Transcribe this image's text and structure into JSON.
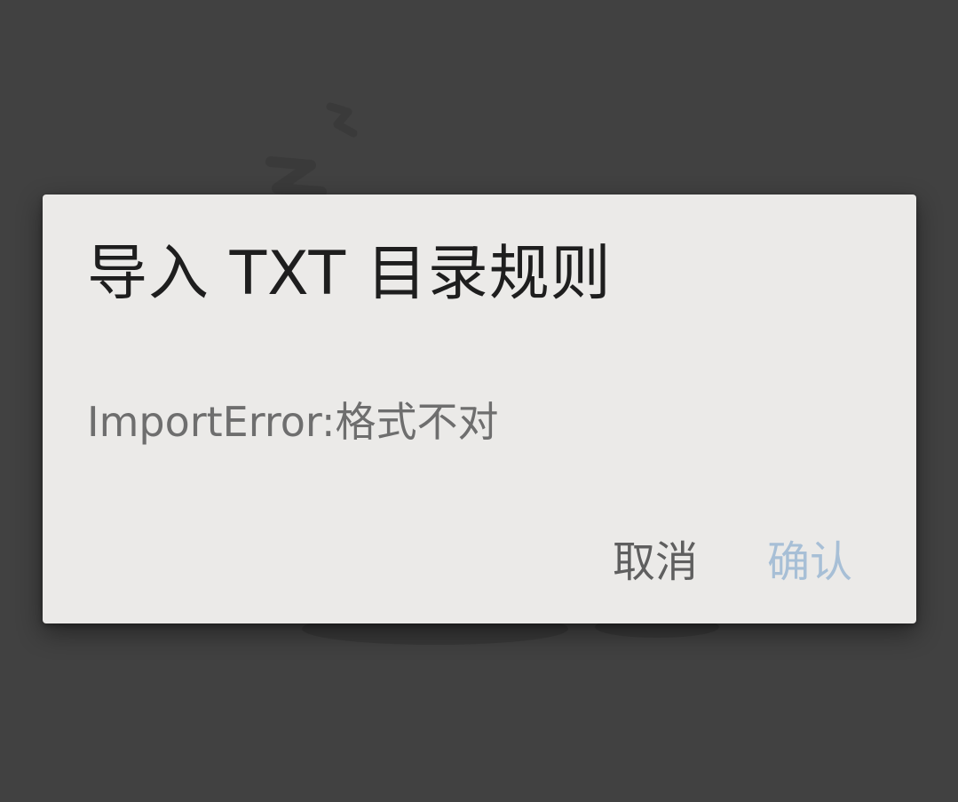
{
  "dialog": {
    "title": "导入 TXT 目录规则",
    "message": "ImportError:格式不对",
    "cancel_label": "取消",
    "confirm_label": "确认"
  },
  "colors": {
    "scrim": "#414141",
    "dialog_background": "#ebeae8",
    "title_text": "#1e1e1e",
    "message_text": "#6e6e6e",
    "cancel_text": "#5f5f5f",
    "confirm_text": "#a7bfd6"
  }
}
